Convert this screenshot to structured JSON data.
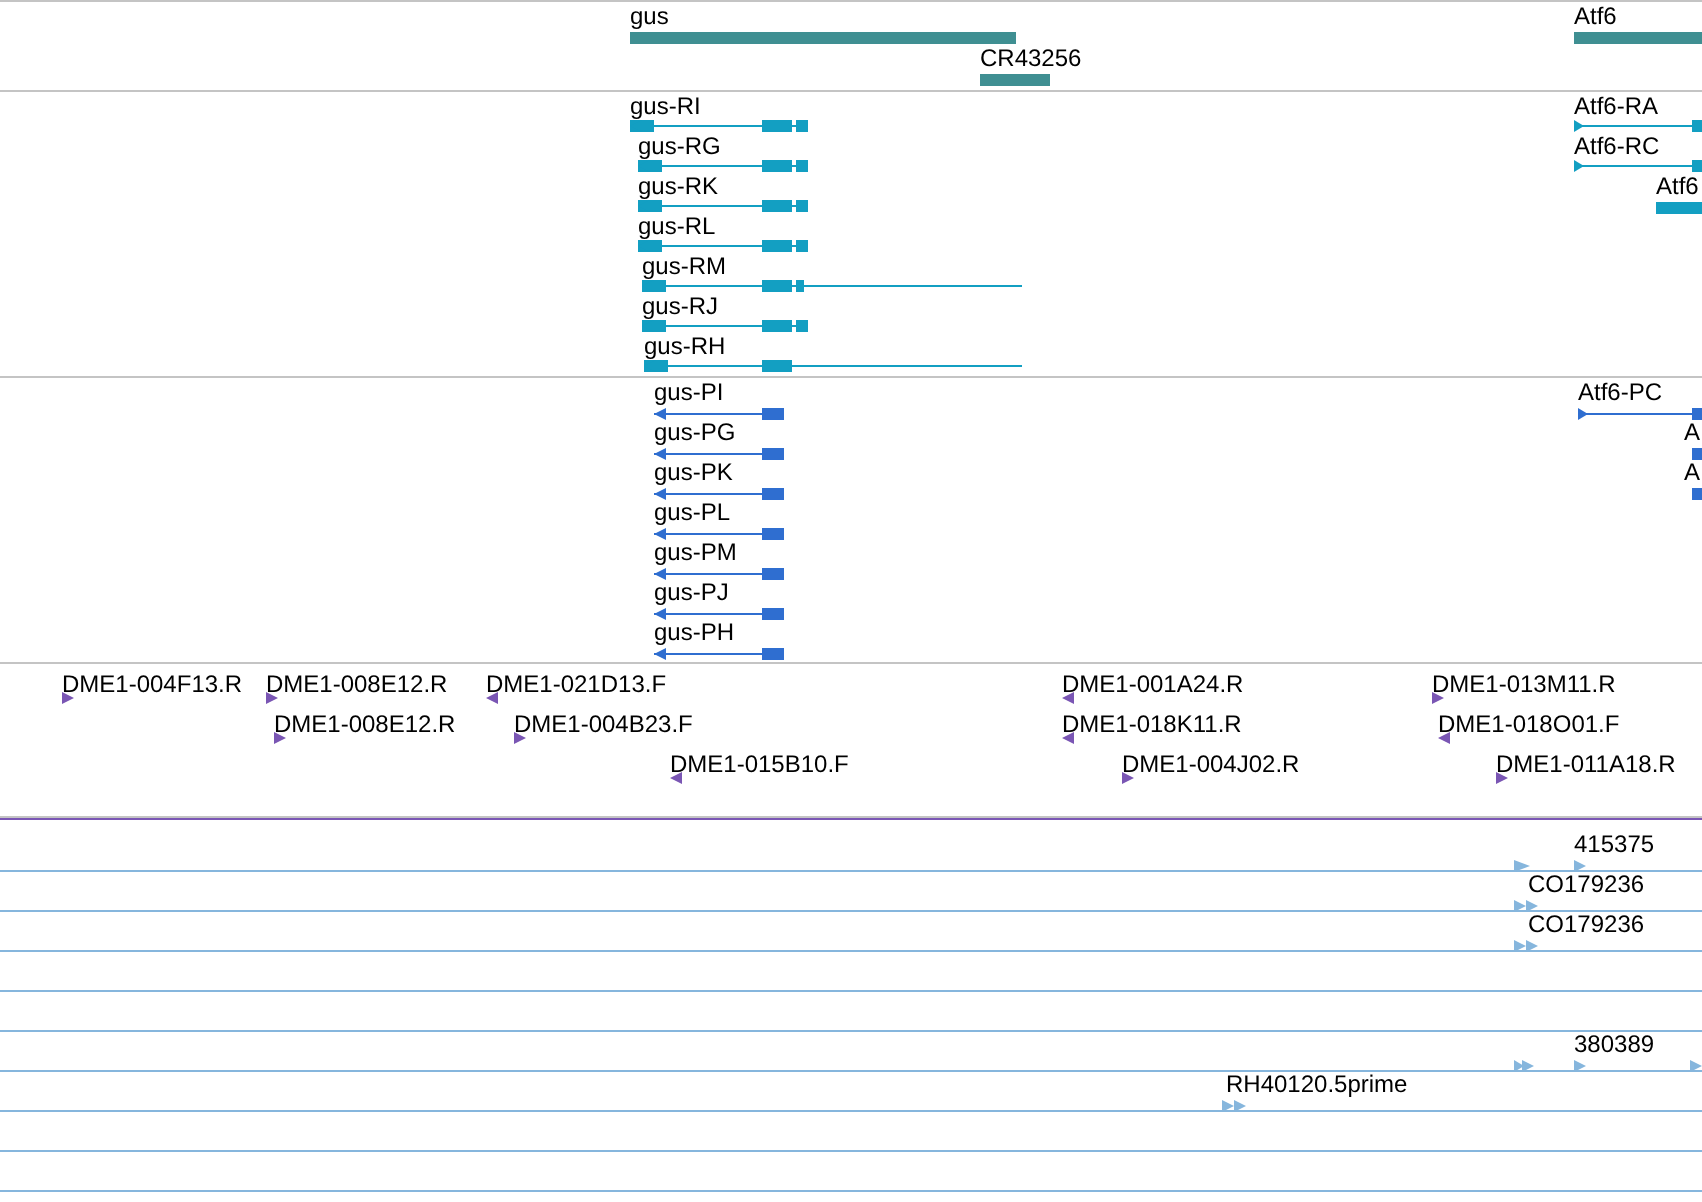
{
  "tracks": [
    {
      "kind": "gene",
      "features": [
        {
          "label": "gus"
        },
        {
          "label": "CR43256"
        },
        {
          "label": "Atf6"
        }
      ]
    },
    {
      "kind": "transcript",
      "features": [
        {
          "label": "gus-RI"
        },
        {
          "label": "gus-RG"
        },
        {
          "label": "gus-RK"
        },
        {
          "label": "gus-RL"
        },
        {
          "label": "gus-RM"
        },
        {
          "label": "gus-RJ"
        },
        {
          "label": "gus-RH"
        },
        {
          "label": "Atf6-RA"
        },
        {
          "label": "Atf6-RC"
        },
        {
          "label": "Atf6"
        }
      ]
    },
    {
      "kind": "protein",
      "features": [
        {
          "label": "gus-PI"
        },
        {
          "label": "gus-PG"
        },
        {
          "label": "gus-PK"
        },
        {
          "label": "gus-PL"
        },
        {
          "label": "gus-PM"
        },
        {
          "label": "gus-PJ"
        },
        {
          "label": "gus-PH"
        },
        {
          "label": "Atf6-PC"
        },
        {
          "label": "A"
        },
        {
          "label": "A"
        }
      ]
    },
    {
      "kind": "clone",
      "features": [
        {
          "label": "DME1-004F13.R"
        },
        {
          "label": "DME1-008E12.R"
        },
        {
          "label": "DME1-021D13.F"
        },
        {
          "label": "DME1-008E12.R"
        },
        {
          "label": "DME1-004B23.F"
        },
        {
          "label": "DME1-015B10.F"
        },
        {
          "label": "DME1-001A24.R"
        },
        {
          "label": "DME1-018K11.R"
        },
        {
          "label": "DME1-004J02.R"
        },
        {
          "label": "DME1-013M11.R"
        },
        {
          "label": "DME1-018O01.F"
        },
        {
          "label": "DME1-011A18.R"
        }
      ]
    },
    {
      "kind": "est",
      "features": [
        {
          "label": "415375"
        },
        {
          "label": "CO179236"
        },
        {
          "label": "CO179236"
        },
        {
          "label": "380389"
        },
        {
          "label": "RH40120.5prime"
        }
      ]
    }
  ]
}
